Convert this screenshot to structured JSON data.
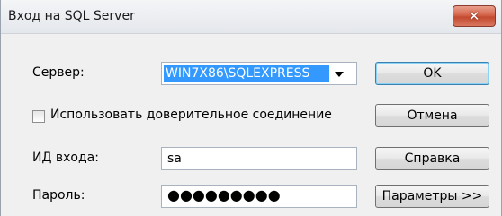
{
  "window": {
    "title": "Вход на SQL Server",
    "close_glyph": "✕"
  },
  "form": {
    "server_label": "Сервер:",
    "server_value": "WIN7X86\\SQLEXPRESS",
    "trusted_label": "Использовать доверительное соединение",
    "trusted_checked": false,
    "login_label": "ИД входа:",
    "login_value": "sa",
    "password_label": "Пароль:",
    "password_mask": "●●●●●●●●●"
  },
  "buttons": {
    "ok": "OK",
    "cancel": "Отмена",
    "help": "Справка",
    "options": "Параметры >>"
  },
  "colors": {
    "selection": "#3399ff",
    "close": "#c24a2f",
    "default_button_border": "#3c7fb1"
  }
}
